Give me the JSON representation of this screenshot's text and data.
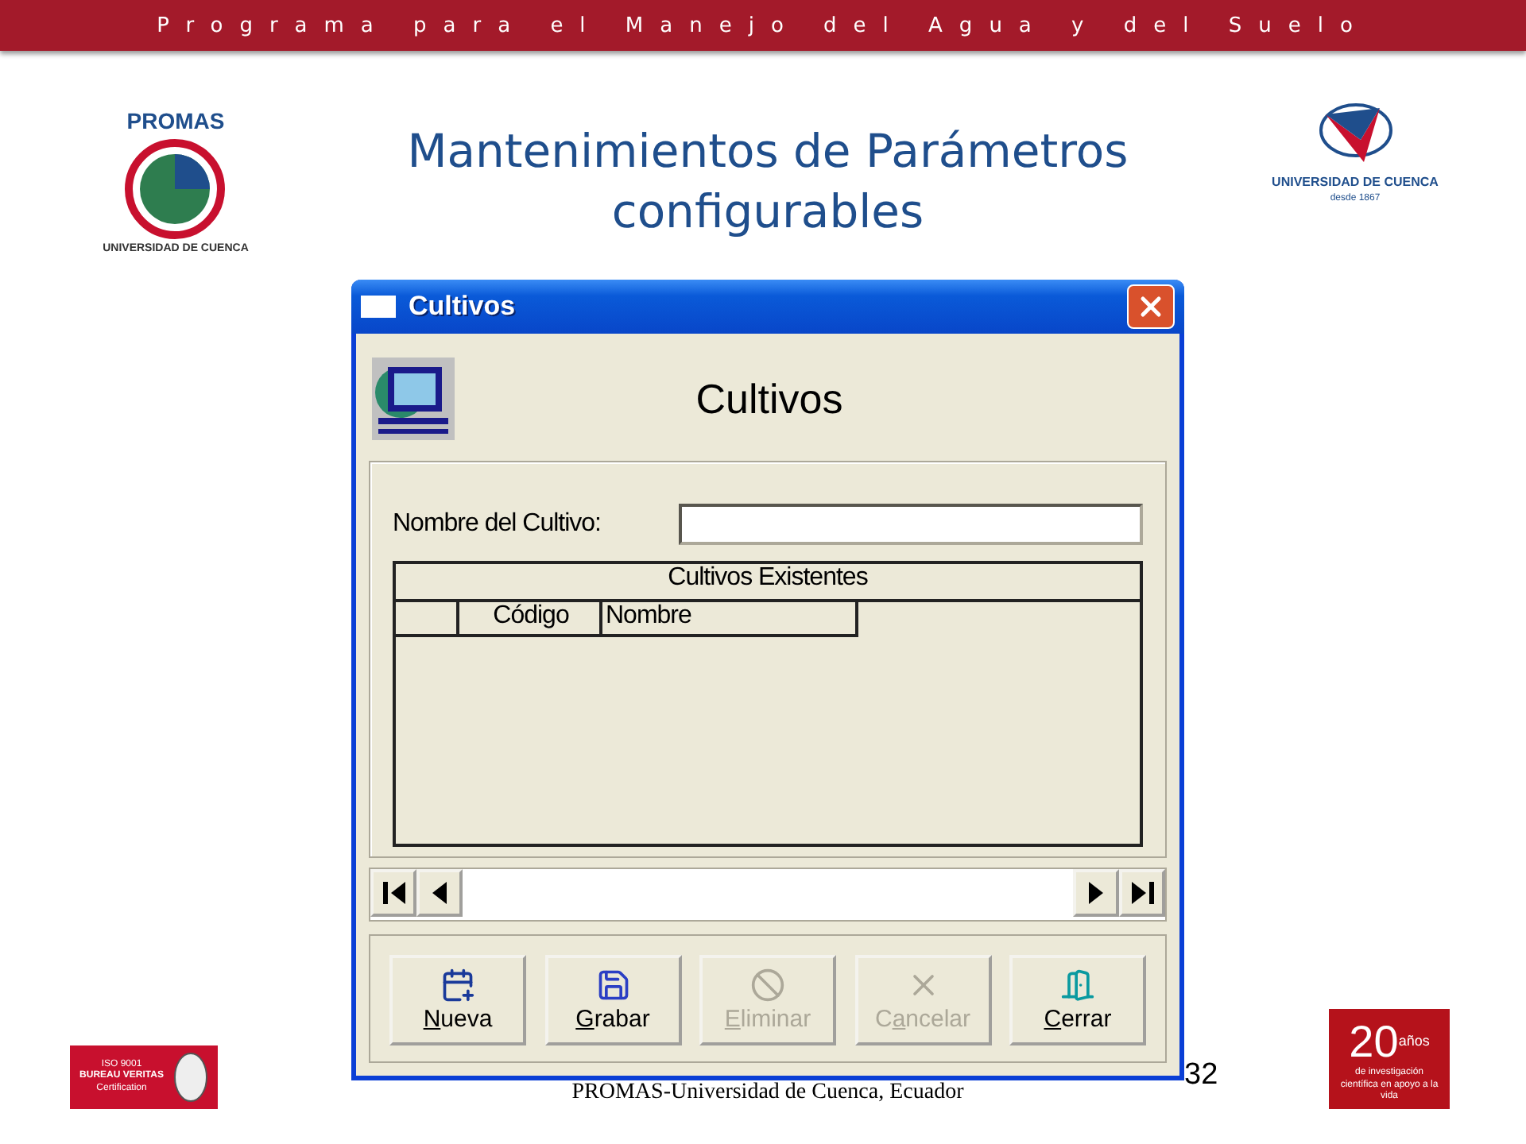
{
  "header": {
    "title": "Programa para el Manejo del Agua y del Suelo"
  },
  "logos": {
    "promas": {
      "name": "PROMAS",
      "caption": "UNIVERSIDAD DE CUENCA"
    },
    "university": {
      "name": "UNIVERSIDAD DE CUENCA",
      "since": "desde 1867"
    },
    "certification": {
      "standard": "ISO 9001",
      "issuer": "BUREAU VERITAS",
      "type": "Certification"
    },
    "anniversary": {
      "number": "20",
      "unit": "años",
      "caption": "de investigación científica en apoyo a la vida"
    }
  },
  "slide_title": "Mantenimientos de Parámetros configurables",
  "dialog": {
    "title": "Cultivos",
    "heading": "Cultivos",
    "field": {
      "label": "Nombre del Cultivo:"
    },
    "grid": {
      "caption": "Cultivos Existentes",
      "columns": [
        "Código",
        "Nombre"
      ]
    },
    "buttons": [
      {
        "key": "N",
        "after": "ueva",
        "disabled": false,
        "kind": "new"
      },
      {
        "key": "G",
        "after": "rabar",
        "disabled": false,
        "kind": "save"
      },
      {
        "key": "E",
        "after": "liminar",
        "disabled": true,
        "kind": "delete"
      },
      {
        "before": "C",
        "key": "a",
        "after": "ncelar",
        "disabled": true,
        "kind": "cancel"
      },
      {
        "key": "C",
        "after": "errar",
        "disabled": false,
        "kind": "close"
      }
    ]
  },
  "footer": {
    "text": "PROMAS-Universidad de Cuenca, Ecuador",
    "page": "32"
  }
}
